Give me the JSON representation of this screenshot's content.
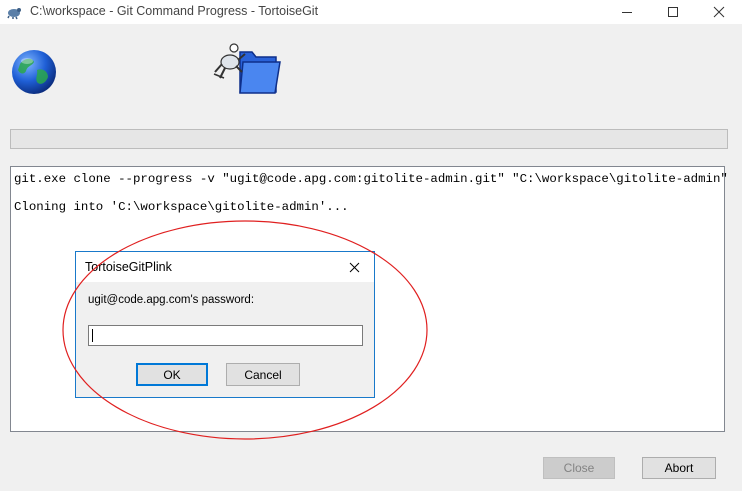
{
  "window": {
    "title": "C:\\workspace - Git Command Progress - TortoiseGit",
    "icons": {
      "app": "tortoisegit-app-icon",
      "minimize": "minimize-icon",
      "maximize": "maximize-icon",
      "close": "close-icon"
    }
  },
  "header": {
    "globe_icon": "globe-icon",
    "animation_icon": "tortoise-folder-animation-icon"
  },
  "progress": {
    "value": 0
  },
  "log": {
    "lines": [
      "git.exe clone --progress -v \"ugit@code.apg.com:gitolite-admin.git\" \"C:\\workspace\\gitolite-admin\"",
      "Cloning into 'C:\\workspace\\gitolite-admin'..."
    ]
  },
  "buttons": {
    "close_label": "Close",
    "abort_label": "Abort"
  },
  "dialog": {
    "title": "TortoiseGitPlink",
    "prompt": "ugit@code.apg.com's password:",
    "password_value": "",
    "ok_label": "OK",
    "cancel_label": "Cancel"
  },
  "colors": {
    "accent": "#0078d7",
    "dialog_border": "#1979ca",
    "annotation": "#e02020"
  }
}
